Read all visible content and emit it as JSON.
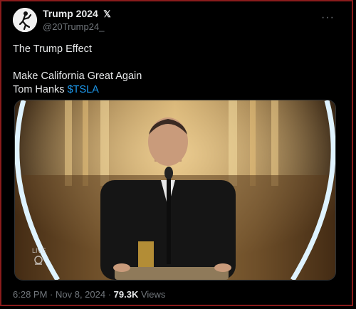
{
  "author": {
    "display_name": "Trump 2024",
    "badge": "𝕏",
    "handle": "@20Trump24_"
  },
  "tweet": {
    "line1": "The Trump Effect",
    "line2": "Make California Great Again",
    "line3_prefix": "Tom Hanks ",
    "cashtag": "$TSLA"
  },
  "media": {
    "network_watermark": "LIVE"
  },
  "meta": {
    "time": "6:28 PM",
    "sep1": " · ",
    "date": "Nov 8, 2024",
    "sep2": " · ",
    "views_count": "79.3K",
    "views_label": " Views"
  },
  "icons": {
    "more": "more-dots-icon",
    "avatar": "silhouette-avatar"
  },
  "colors": {
    "background": "#000000",
    "link": "#1d9bf0",
    "muted": "#71767b",
    "text": "#e7e9ea"
  }
}
